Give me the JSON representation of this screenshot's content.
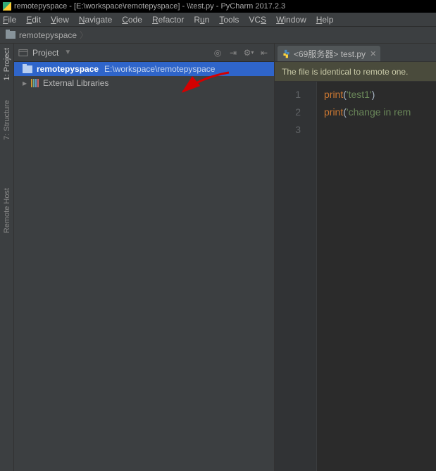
{
  "window": {
    "title": "remotepyspace - [E:\\workspace\\remotepyspace] - \\\\test.py - PyCharm 2017.2.3"
  },
  "menu": [
    "File",
    "Edit",
    "View",
    "Navigate",
    "Code",
    "Refactor",
    "Run",
    "Tools",
    "VCS",
    "Window",
    "Help"
  ],
  "breadcrumb": {
    "label": "remotepyspace"
  },
  "sidebar": [
    {
      "label": "1: Project",
      "active": true
    },
    {
      "label": "7: Structure",
      "active": false
    },
    {
      "label": "Remote Host",
      "active": false
    }
  ],
  "project_panel": {
    "title": "Project",
    "items": [
      {
        "type": "folder",
        "name": "remotepyspace",
        "path": "E:\\workspace\\remotepyspace",
        "selected": true
      },
      {
        "type": "lib",
        "name": "External Libraries",
        "selected": false
      }
    ]
  },
  "tabs": [
    {
      "icon": "python",
      "label": "<69服务器> test.py",
      "closeable": true
    }
  ],
  "banner": "The file is identical to remote one.",
  "code": {
    "lines": [
      {
        "n": 1,
        "tokens": [
          [
            "kw",
            "print"
          ],
          [
            "p",
            "("
          ],
          [
            "str",
            "'test1'"
          ],
          [
            "p",
            ")"
          ]
        ]
      },
      {
        "n": 2,
        "tokens": [
          [
            "kw",
            "print"
          ],
          [
            "p",
            "("
          ],
          [
            "str",
            "'change in rem"
          ]
        ]
      },
      {
        "n": 3,
        "tokens": []
      }
    ]
  }
}
